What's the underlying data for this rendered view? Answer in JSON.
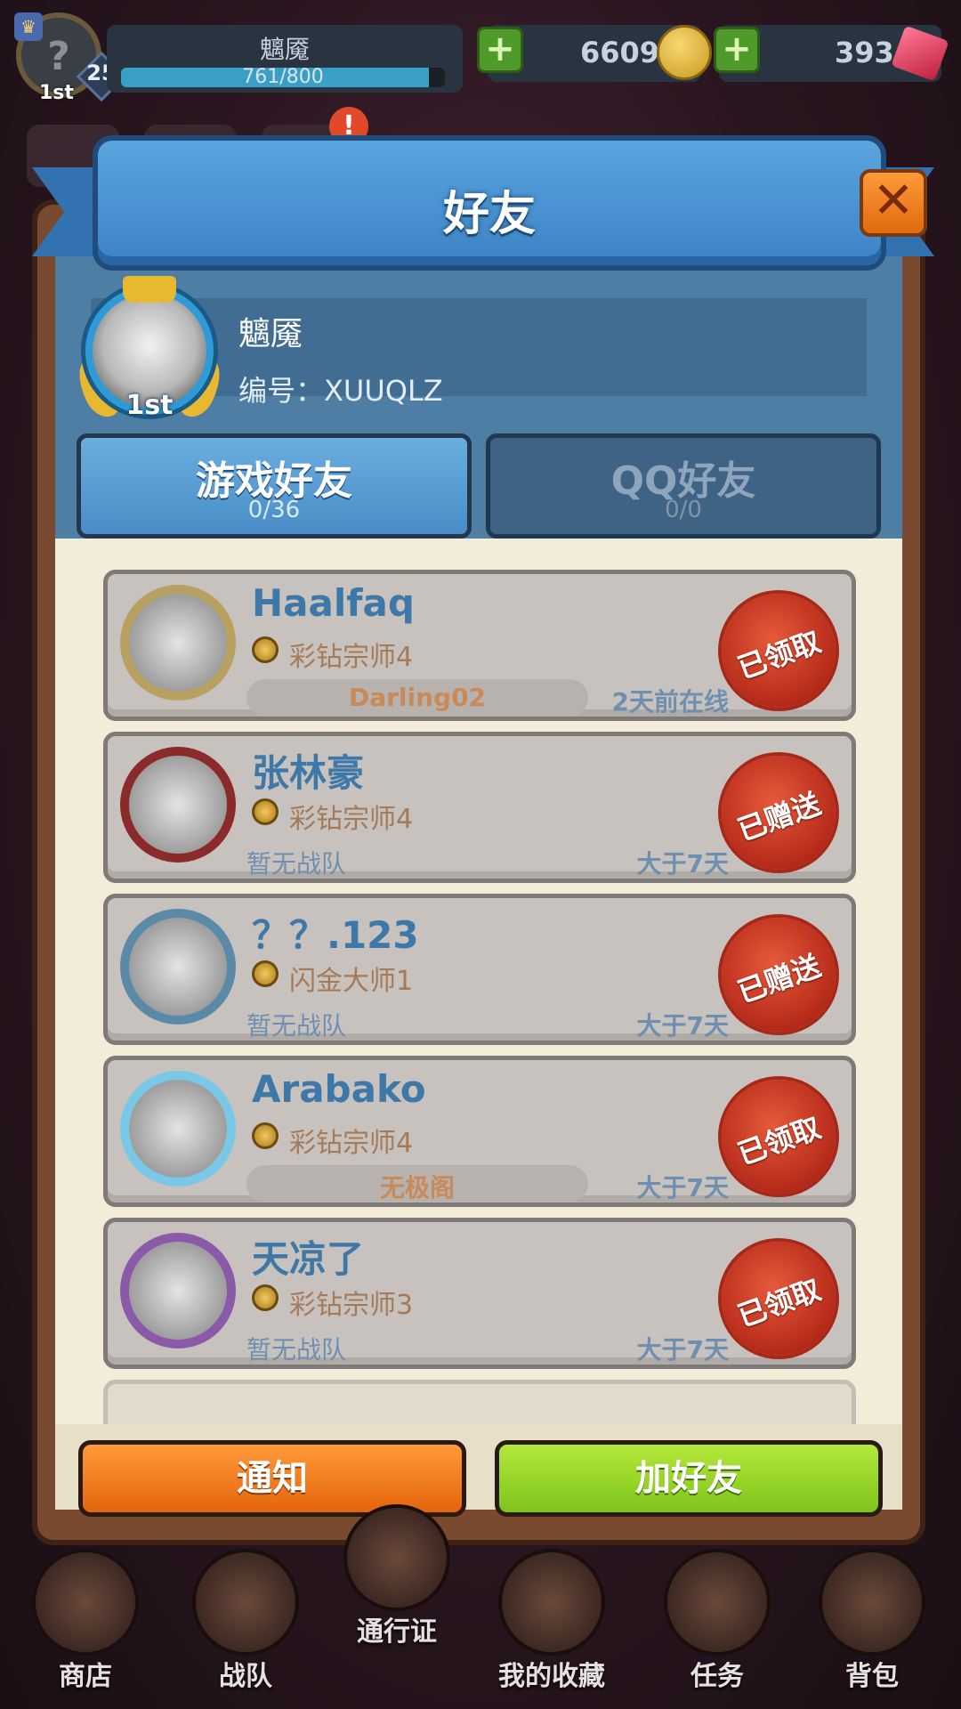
{
  "hud": {
    "player_name": "魑魇",
    "level": "25",
    "rank": "1st",
    "xp_text": "761/800",
    "xp_fraction": 0.95,
    "gold": "6609",
    "gems": "393",
    "alert": "!"
  },
  "dialog": {
    "title": "好友",
    "close": "✕",
    "me": {
      "name": "魑魇",
      "id": "编号：XUUQLZ",
      "rank": "1st"
    },
    "tabs": [
      {
        "label": "游戏好友",
        "count": "0/36"
      },
      {
        "label": "QQ好友",
        "count": "0/0"
      }
    ],
    "friends": [
      {
        "name": "Haalfaq",
        "tier": "彩钻宗师4",
        "team": "Darling02",
        "team_pill": true,
        "online": "2天前在线",
        "seal": "已领取",
        "frame_color": "#b8a060"
      },
      {
        "name": "张林豪",
        "tier": "彩钻宗师4",
        "team": "暂无战队",
        "team_pill": false,
        "online": "大于7天",
        "seal": "已赠送",
        "frame_color": "#8a2a2a"
      },
      {
        "name": "？？.123",
        "tier": "闪金大师1",
        "team": "暂无战队",
        "team_pill": false,
        "online": "大于7天",
        "seal": "已赠送",
        "frame_color": "#5a8aa8"
      },
      {
        "name": "Arabako",
        "tier": "彩钻宗师4",
        "team": "无极阁",
        "team_pill": true,
        "online": "大于7天",
        "seal": "已领取",
        "frame_color": "#7ac8e8"
      },
      {
        "name": "天凉了",
        "tier": "彩钻宗师3",
        "team": "暂无战队",
        "team_pill": false,
        "online": "大于7天",
        "seal": "已领取",
        "frame_color": "#8a5aa8"
      }
    ],
    "buttons": {
      "notify": "通知",
      "add": "加好友"
    }
  },
  "nav": [
    "商店",
    "战队",
    "通行证",
    "我的收藏",
    "任务",
    "背包"
  ]
}
